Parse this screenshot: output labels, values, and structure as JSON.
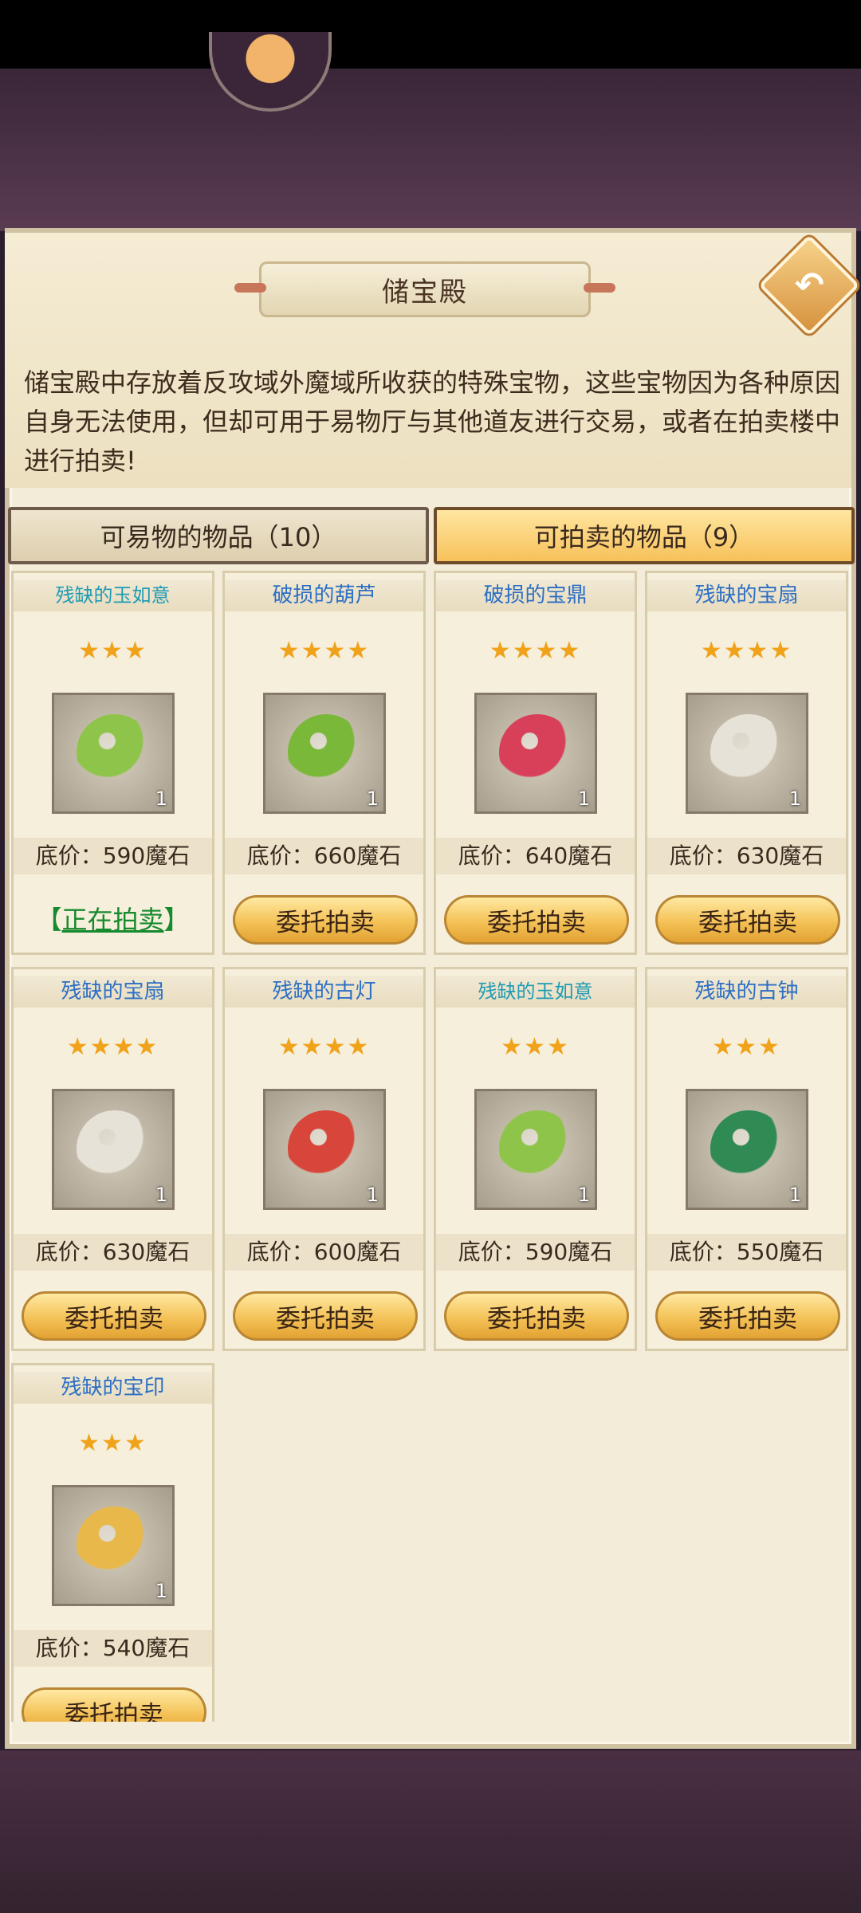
{
  "header": {
    "title": "储宝殿",
    "description": "储宝殿中存放着反攻域外魔域所收获的特殊宝物，这些宝物因为各种原因自身无法使用，但却可用于易物厅与其他道友进行交易，或者在拍卖楼中进行拍卖!"
  },
  "tabs": [
    {
      "label": "可易物的物品（10）",
      "active": false
    },
    {
      "label": "可拍卖的物品（9）",
      "active": true
    }
  ],
  "colors": {
    "accent_gold": "#f4c257",
    "name_blue": "#2c6fc4",
    "name_teal": "#1f9bb4",
    "star_gold": "#f0a21a",
    "status_green": "#168a2e"
  },
  "items": [
    {
      "name": "残缺的玉如意",
      "stars": "★★★",
      "qty": "1",
      "price": "底价：590魔石",
      "action": "",
      "status_prefix": "【",
      "status_link": "正在拍卖",
      "status_suffix": "】",
      "icon": "jade-ruyi-icon",
      "color": "#8fc44a"
    },
    {
      "name": "破损的葫芦",
      "stars": "★★★★",
      "qty": "1",
      "price": "底价：660魔石",
      "action": "委托拍卖",
      "icon": "gourd-icon",
      "color": "#7ab83a"
    },
    {
      "name": "破损的宝鼎",
      "stars": "★★★★",
      "qty": "1",
      "price": "底价：640魔石",
      "action": "委托拍卖",
      "icon": "cauldron-icon",
      "color": "#d8405a"
    },
    {
      "name": "残缺的宝扇",
      "stars": "★★★★",
      "qty": "1",
      "price": "底价：630魔石",
      "action": "委托拍卖",
      "icon": "fan-icon",
      "color": "#e6e2d8"
    },
    {
      "name": "残缺的宝扇",
      "stars": "★★★★",
      "qty": "1",
      "price": "底价：630魔石",
      "action": "委托拍卖",
      "icon": "fan-icon",
      "color": "#e6e2d8"
    },
    {
      "name": "残缺的古灯",
      "stars": "★★★★",
      "qty": "1",
      "price": "底价：600魔石",
      "action": "委托拍卖",
      "icon": "lantern-icon",
      "color": "#d8453a"
    },
    {
      "name": "残缺的玉如意",
      "stars": "★★★",
      "qty": "1",
      "price": "底价：590魔石",
      "action": "委托拍卖",
      "icon": "jade-ruyi-icon",
      "color": "#8fc44a"
    },
    {
      "name": "残缺的古钟",
      "stars": "★★★",
      "qty": "1",
      "price": "底价：550魔石",
      "action": "委托拍卖",
      "icon": "bell-icon",
      "color": "#2f8a54"
    },
    {
      "name": "残缺的宝印",
      "stars": "★★★",
      "qty": "1",
      "price": "底价：540魔石",
      "action": "委托拍卖",
      "icon": "seal-icon",
      "color": "#e8b84a"
    }
  ]
}
